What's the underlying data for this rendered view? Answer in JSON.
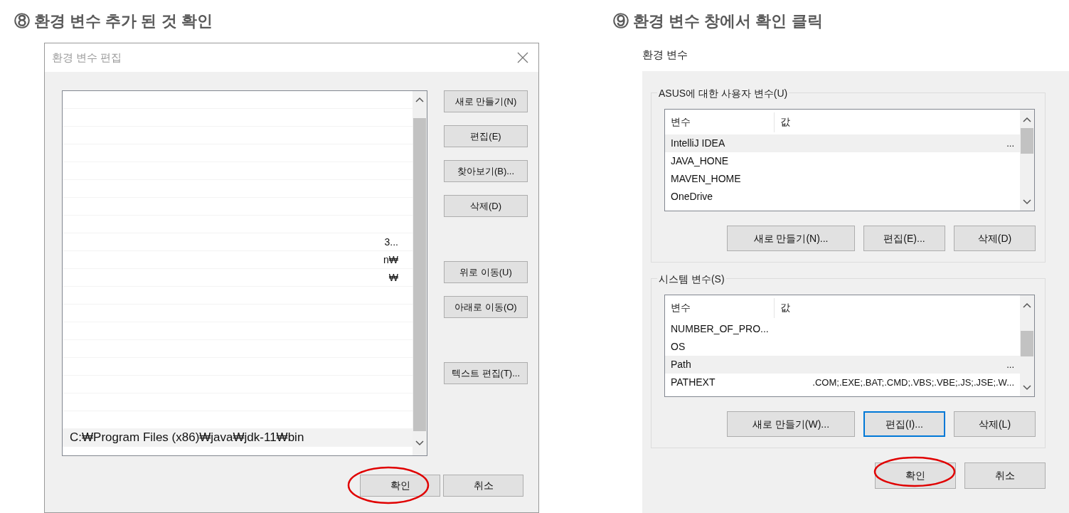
{
  "left_step": {
    "heading": "⑧ 환경 변수 추가 된 것 확인",
    "dialog": {
      "title": "환경 변수 편집",
      "list_rows": [
        {
          "selected": false
        },
        {
          "selected": false
        },
        {
          "selected": false
        },
        {
          "selected": false
        },
        {
          "selected": false
        },
        {
          "selected": false
        },
        {
          "selected": false
        },
        {
          "selected": false
        },
        {
          "fragment": "3...",
          "selected": false
        },
        {
          "fragment": "n₩",
          "selected": false
        },
        {
          "fragment": "₩",
          "selected": false
        },
        {
          "selected": false
        },
        {
          "selected": false
        },
        {
          "selected": false
        },
        {
          "selected": false
        },
        {
          "selected": false
        },
        {
          "selected": false
        },
        {
          "selected": false
        },
        {
          "selected": false
        },
        {
          "text": "C:₩Program Files (x86)₩java₩jdk-11₩bin",
          "selected": true
        }
      ],
      "side_button_groups": [
        [
          "새로 만들기(N)",
          "편집(E)",
          "찾아보기(B)...",
          "삭제(D)"
        ],
        [
          "위로 이동(U)",
          "아래로 이동(O)"
        ],
        [
          "텍스트 편집(T)..."
        ]
      ],
      "footer_buttons": [
        {
          "label": "확인",
          "circled": true
        },
        {
          "label": "취소",
          "circled": false
        }
      ]
    }
  },
  "right_step": {
    "heading": "⑨ 환경 변수 창에서 확인 클릭",
    "dialog": {
      "title": "환경 변수",
      "groups": [
        {
          "legend": "ASUS에 대한 사용자 변수(U)",
          "columns": [
            "변수",
            "값"
          ],
          "rows": [
            {
              "name": "IntelliJ IDEA",
              "value": "...",
              "selected": true
            },
            {
              "name": "JAVA_HONE",
              "selected": false
            },
            {
              "name": "MAVEN_HOME",
              "selected": false
            },
            {
              "name": "OneDrive",
              "selected": false
            }
          ],
          "buttons": [
            {
              "label": "새로 만들기(N)...",
              "focused": false
            },
            {
              "label": "편집(E)...",
              "focused": false
            },
            {
              "label": "삭제(D)",
              "focused": false
            }
          ]
        },
        {
          "legend": "시스템 변수(S)",
          "columns": [
            "변수",
            "값"
          ],
          "rows": [
            {
              "name": "NUMBER_OF_PRO...",
              "selected": false
            },
            {
              "name": "OS",
              "selected": false
            },
            {
              "name": "Path",
              "value": "...",
              "selected": true
            },
            {
              "name": "PATHEXT",
              "value": ".COM;.EXE;.BAT;.CMD;.VBS;.VBE;.JS;.JSE;.W...",
              "selected": false
            }
          ],
          "buttons": [
            {
              "label": "새로 만들기(W)...",
              "focused": false
            },
            {
              "label": "편집(I)...",
              "focused": true
            },
            {
              "label": "삭제(L)",
              "focused": false
            }
          ]
        }
      ],
      "footer_buttons": [
        {
          "label": "확인",
          "circled": true
        },
        {
          "label": "취소",
          "circled": false
        }
      ]
    }
  }
}
